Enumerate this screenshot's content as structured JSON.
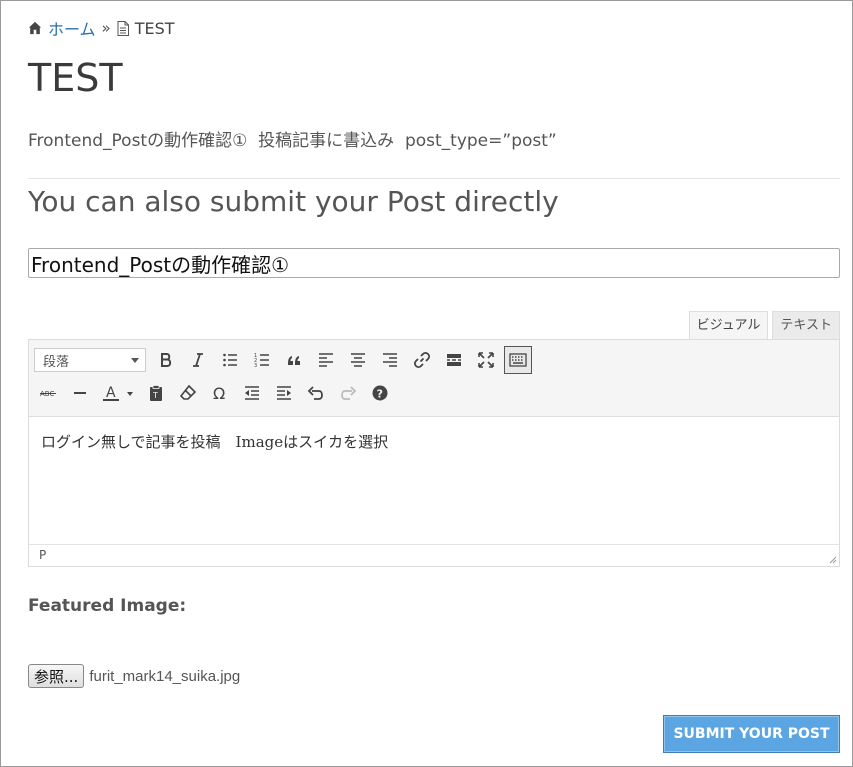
{
  "breadcrumb": {
    "home_label": "ホーム",
    "separator": "»",
    "current": "TEST"
  },
  "page": {
    "title": "TEST",
    "description": "Frontend_Postの動作確認①  投稿記事に書込み  post_type=”post”",
    "section_title": "You can also submit your Post directly"
  },
  "form": {
    "post_title_value": "Frontend_Postの動作確認①",
    "editor": {
      "tabs": [
        {
          "label": "ビジュアル",
          "active": true
        },
        {
          "label": "テキスト",
          "active": false
        }
      ],
      "format_select": "段落",
      "toolbar_row1": [
        "bold-icon",
        "italic-icon",
        "bullet-list-icon",
        "numbered-list-icon",
        "blockquote-icon",
        "align-left-icon",
        "align-center-icon",
        "align-right-icon",
        "link-icon",
        "read-more-icon",
        "fullscreen-icon",
        "toolbar-toggle-icon"
      ],
      "toolbar_row2": [
        "strikethrough-icon",
        "horizontal-line-icon",
        "text-color-icon",
        "paste-text-icon",
        "clear-formatting-icon",
        "special-character-icon",
        "outdent-icon",
        "indent-icon",
        "undo-icon",
        "redo-icon",
        "help-icon"
      ],
      "content": "ログイン無しで記事を投稿　Imageはスイカを選択",
      "status_path": "P"
    },
    "featured_image_label": "Featured Image:",
    "browse_button_label": "参照...",
    "selected_file": "furit_mark14_suika.jpg",
    "submit_label": "SUBMIT YOUR POST"
  },
  "colors": {
    "link": "#2a6fb0",
    "submit_bg": "#5ba6e2",
    "text": "#444444"
  }
}
